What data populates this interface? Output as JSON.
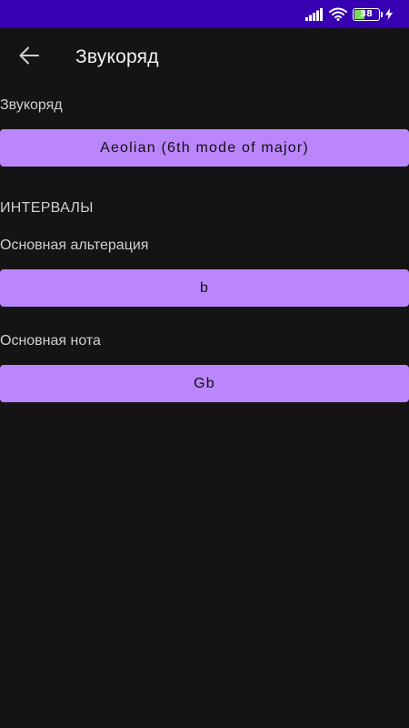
{
  "status_bar": {
    "battery_level": "38",
    "battery_fraction": 0.38,
    "background_color": "#3700b3",
    "icons": [
      "signal-icon",
      "wifi-icon",
      "battery-icon",
      "charging-icon"
    ]
  },
  "app_bar": {
    "back_icon": "arrow-left-icon",
    "title": "Звукоряд"
  },
  "scale": {
    "label": "Звукоряд",
    "value": "Aeolian (6th mode of major)"
  },
  "intervals": {
    "header": "ИНТЕРВАЛЫ",
    "alteration_label": "Основная альтерация",
    "alteration_value": "b",
    "note_label": "Основная нота",
    "note_value": "Gb"
  },
  "colors": {
    "background": "#141414",
    "accent": "#bb86fc",
    "status_bar": "#3700b3"
  }
}
